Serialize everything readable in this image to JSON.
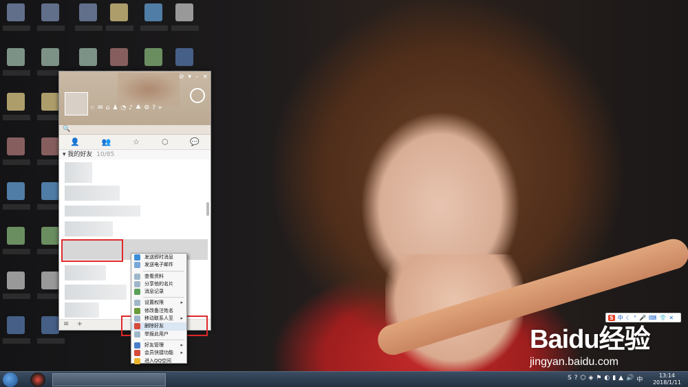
{
  "qq_window": {
    "window_buttons": [
      "⊘",
      "▾",
      "–",
      "×"
    ],
    "toolbar_icons": [
      "☆",
      "✉",
      "⌂",
      "♟",
      "◔",
      "♪",
      "♣",
      "⚙",
      "?",
      "»"
    ],
    "search_icon": "🔍",
    "tabs": [
      "contacts-icon",
      "groups-icon",
      "star-icon",
      "discuss-icon",
      "chat-icon"
    ],
    "tab_glyphs": [
      "👤",
      "👥",
      "☆",
      "⬡",
      "💬"
    ],
    "group_header": "我的好友",
    "group_count": "10/85",
    "bottom_add": "+",
    "bottom_menu": "≡"
  },
  "context_menu": {
    "items": [
      {
        "label": "发送即时消息",
        "icon_color": "#3c8ed9",
        "submenu": false
      },
      {
        "label": "发送电子邮件",
        "icon_color": "#7aa7d9",
        "submenu": false
      },
      {
        "sep": true
      },
      {
        "label": "查看资料",
        "icon_color": "#9fb7c9",
        "submenu": false
      },
      {
        "label": "分享他的名片",
        "icon_color": "#9fb7c9",
        "submenu": false
      },
      {
        "label": "消息记录",
        "icon_color": "#5aa05a",
        "submenu": false
      },
      {
        "sep": true
      },
      {
        "label": "设置权限",
        "icon_color": "#9fb7c9",
        "submenu": true
      },
      {
        "label": "修改备注姓名",
        "icon_color": "#6a9a3a",
        "submenu": false
      },
      {
        "label": "移动联系人至",
        "icon_color": "#9fb7c9",
        "submenu": true
      },
      {
        "label": "删除好友",
        "icon_color": "#d64a3a",
        "submenu": false
      },
      {
        "label": "举报此用户",
        "icon_color": "#9fb7c9",
        "submenu": false
      },
      {
        "sep": true
      },
      {
        "label": "好友管理",
        "icon_color": "#4a7ec9",
        "submenu": true
      },
      {
        "label": "会员快捷功能",
        "icon_color": "#d64a3a",
        "submenu": true
      },
      {
        "label": "进入QQ空间",
        "icon_color": "#e8b52a",
        "submenu": false
      }
    ]
  },
  "ime_bar": {
    "logo": "S",
    "mode": "中",
    "icons": [
      "☾",
      "°",
      "🎤",
      "⌨",
      "👕",
      "✕"
    ]
  },
  "watermark": {
    "brand": "Baidu经验",
    "url": "jingyan.baidu.com"
  },
  "taskbar": {
    "tray_icons": [
      "S",
      "?",
      "⬡",
      "◈",
      "⚑",
      "◐",
      "▮",
      "▲",
      "🔊",
      "中"
    ],
    "time": "13:14",
    "date": "2018/1/11"
  },
  "colors": {
    "highlight_box": "#e0282a",
    "qq_header": "#c9b9a5",
    "taskbar": "#2d3d50"
  }
}
